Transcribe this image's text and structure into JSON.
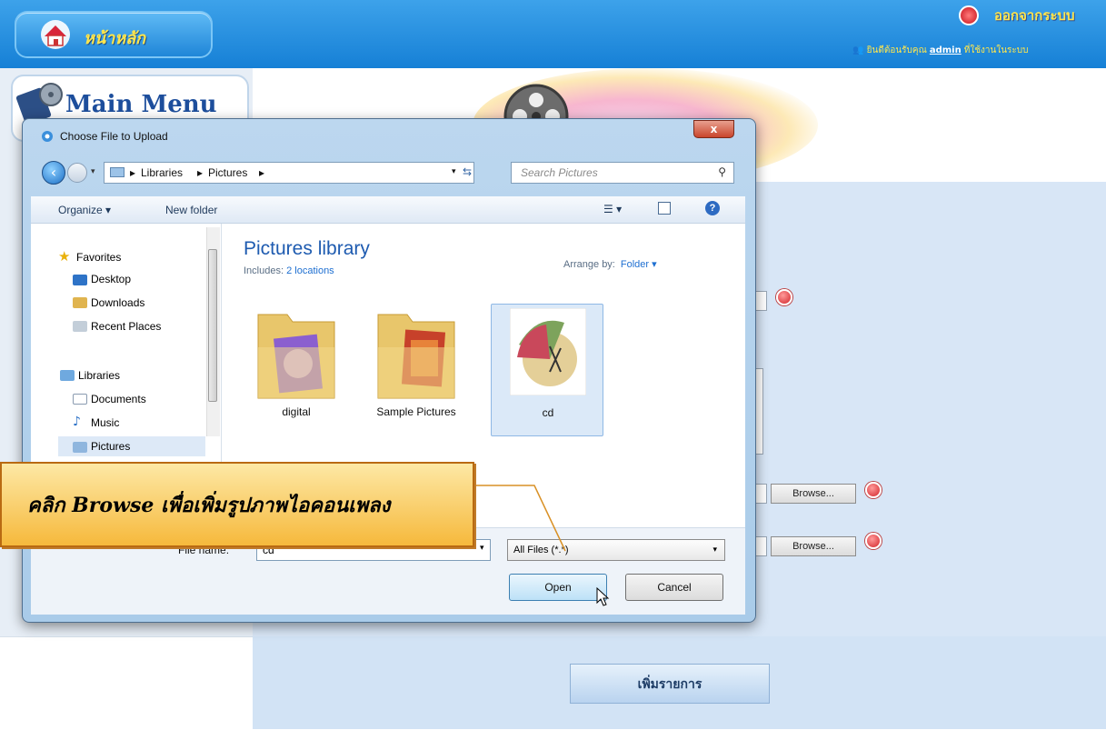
{
  "header": {
    "home_label": "หน้าหลัก",
    "logout_label": "ออกจากระบบ",
    "welcome_prefix": "ยินดีต้อนรับคุณ",
    "username": "admin",
    "welcome_suffix": "ที่ใช้งานในระบบ"
  },
  "sidebar": {
    "title": "Main Menu"
  },
  "form": {
    "browse_label": "Browse...",
    "add_button_label": "เพิ่มรายการ"
  },
  "dialog": {
    "title": "Choose File to Upload",
    "close_label": "x",
    "breadcrumb": [
      "Libraries",
      "Pictures"
    ],
    "search_placeholder": "Search Pictures",
    "toolbar": {
      "organize_label": "Organize ▾",
      "new_folder_label": "New folder"
    },
    "nav": {
      "favorites": "Favorites",
      "desktop": "Desktop",
      "downloads": "Downloads",
      "recent": "Recent Places",
      "libraries": "Libraries",
      "documents": "Documents",
      "music": "Music",
      "pictures": "Pictures"
    },
    "library_title": "Pictures library",
    "includes_label": "Includes:",
    "includes_value": "2 locations",
    "arrange_label": "Arrange by:",
    "arrange_value": "Folder ▾",
    "items": [
      {
        "label": "digital"
      },
      {
        "label": "Sample Pictures"
      },
      {
        "label": "cd"
      }
    ],
    "filename_label": "File name:",
    "filename_value": "cd",
    "filetype_value": "All Files (*.*)",
    "open_label": "Open",
    "cancel_label": "Cancel"
  },
  "callout": {
    "text": "คลิก Browse เพื่อเพิ่มรูปภาพไอคอนเพลง"
  }
}
